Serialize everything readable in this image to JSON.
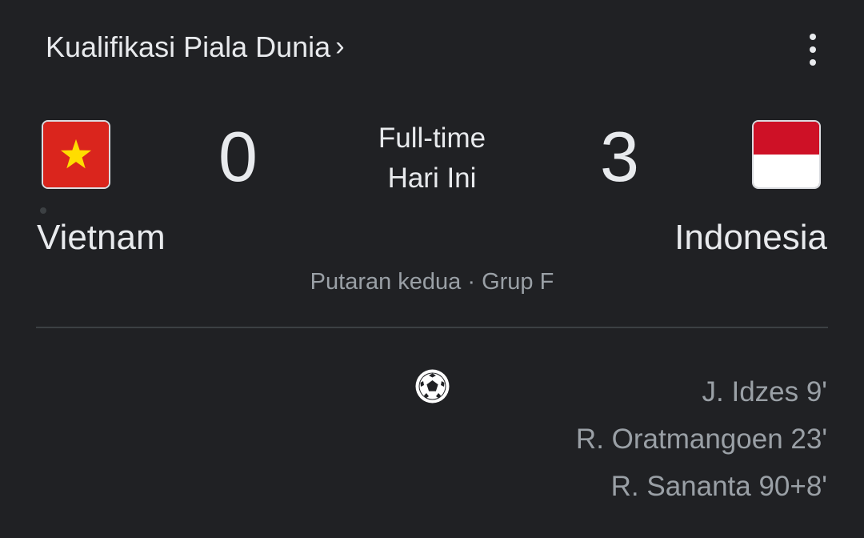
{
  "competition": {
    "name": "Kualifikasi Piala Dunia",
    "chevron": "›"
  },
  "menu_icon": "more-vert-icon",
  "home": {
    "name": "Vietnam",
    "score": "0",
    "flag_colors": {
      "field": "#da251d",
      "star": "#ffdd00"
    }
  },
  "away": {
    "name": "Indonesia",
    "score": "3",
    "flag_colors": {
      "top": "#ce1126",
      "bottom": "#ffffff"
    }
  },
  "status": {
    "line1": "Full-time",
    "line2": "Hari Ini"
  },
  "round": "Putaran kedua · Grup F",
  "goal_icon": "soccer-ball-icon",
  "scorers": [
    "J. Idzes 9'",
    "R. Oratmangoen 23'",
    "R. Sananta 90+8'"
  ]
}
